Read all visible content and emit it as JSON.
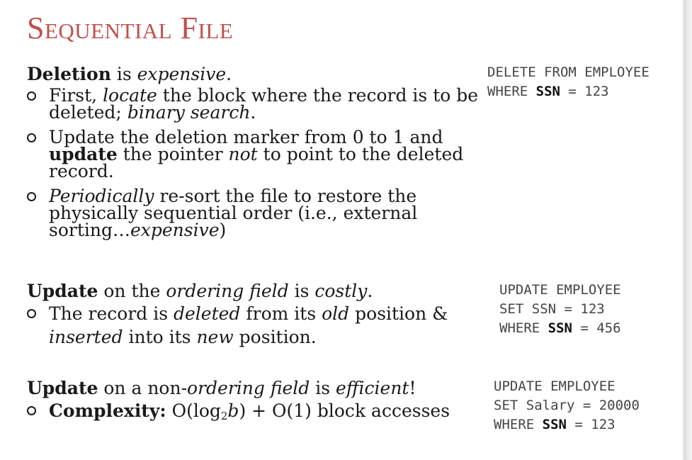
{
  "title": "Sequential File",
  "deletion": {
    "heading": {
      "t1": "Deletion",
      "t2": " is ",
      "t3": "expensive."
    },
    "bullets": [
      {
        "t1": "First, ",
        "t2": "locate",
        "t3": " the block where the record is to be deleted; ",
        "t4": "binary search",
        "t5": "."
      },
      {
        "t1": "Update the deletion marker from 0 to 1 and ",
        "t2": "update",
        "t3": " the pointer ",
        "t4": "not",
        "t5": " to point to the deleted record."
      },
      {
        "t1": "Periodically",
        "t2": " re-sort the file to restore the physically sequential order (i.e., external sorting…",
        "t3": "expensive",
        "t4": ")"
      }
    ],
    "sql": {
      "line1": "DELETE FROM EMPLOYEE",
      "line2_a": "WHERE ",
      "line2_kw": "SSN",
      "line2_b": " = 123"
    }
  },
  "update_ordering": {
    "heading": {
      "t1": "Update",
      "t2": " on the ",
      "t3": "ordering field",
      "t4": " is ",
      "t5": "costly",
      "t6": "."
    },
    "bullets": [
      {
        "t1": "The record is ",
        "t2": "deleted",
        "t3": " from its ",
        "t4": "old",
        "t5": " position & ",
        "t6": "inserted",
        "t7": " into its ",
        "t8": "new",
        "t9": " position."
      }
    ],
    "sql": {
      "line1": "UPDATE EMPLOYEE",
      "line2": "SET SSN = 123",
      "line3_a": "WHERE ",
      "line3_kw": "SSN",
      "line3_b": " = 456"
    }
  },
  "update_nonordering": {
    "heading": {
      "t1": "Update",
      "t2": " on a non-",
      "t3": "ordering field",
      "t4": " is ",
      "t5": "efficient",
      "t6": "!"
    },
    "bullets": [
      {
        "t1": "Complexity:",
        "t2": " O(log",
        "t3": "2",
        "t4": "b",
        "t5": ") + O(1) block accesses"
      }
    ],
    "sql": {
      "line1": "UPDATE EMPLOYEE",
      "line2": "SET Salary = 20000",
      "line3_a": "WHERE ",
      "line3_kw": "SSN",
      "line3_b": " = 123"
    }
  }
}
